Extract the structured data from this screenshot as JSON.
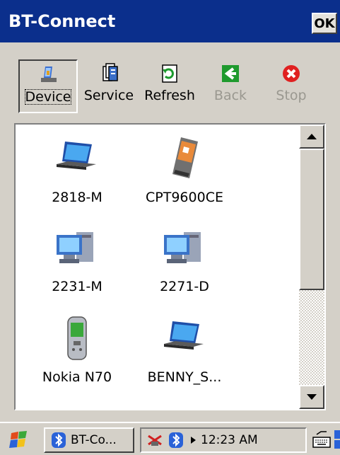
{
  "window": {
    "title": "BT-Connect",
    "ok_label": "OK"
  },
  "toolbar": {
    "buttons": [
      {
        "label": "Device",
        "icon": "device-icon",
        "state": "pressed"
      },
      {
        "label": "Service",
        "icon": "service-icon",
        "state": "enabled"
      },
      {
        "label": "Refresh",
        "icon": "refresh-icon",
        "state": "enabled"
      },
      {
        "label": "Back",
        "icon": "back-arrow-icon",
        "state": "disabled"
      },
      {
        "label": "Stop",
        "icon": "stop-icon",
        "state": "disabled"
      }
    ]
  },
  "devices": [
    {
      "name": "2818-M",
      "icon": "laptop-icon"
    },
    {
      "name": "CPT9600CE",
      "icon": "pda-icon"
    },
    {
      "name": "2231-M",
      "icon": "desktop-computer-icon"
    },
    {
      "name": "2271-D",
      "icon": "desktop-computer-icon"
    },
    {
      "name": "Nokia N70",
      "icon": "phone-icon"
    },
    {
      "name": "BENNY_S...",
      "icon": "laptop-icon"
    }
  ],
  "taskbar": {
    "task_label": "BT-Co...",
    "clock": "12:23 AM"
  },
  "colors": {
    "titlebar": "#0b2f8c",
    "window_bg": "#d4d0c8",
    "list_bg": "#ffffff"
  }
}
